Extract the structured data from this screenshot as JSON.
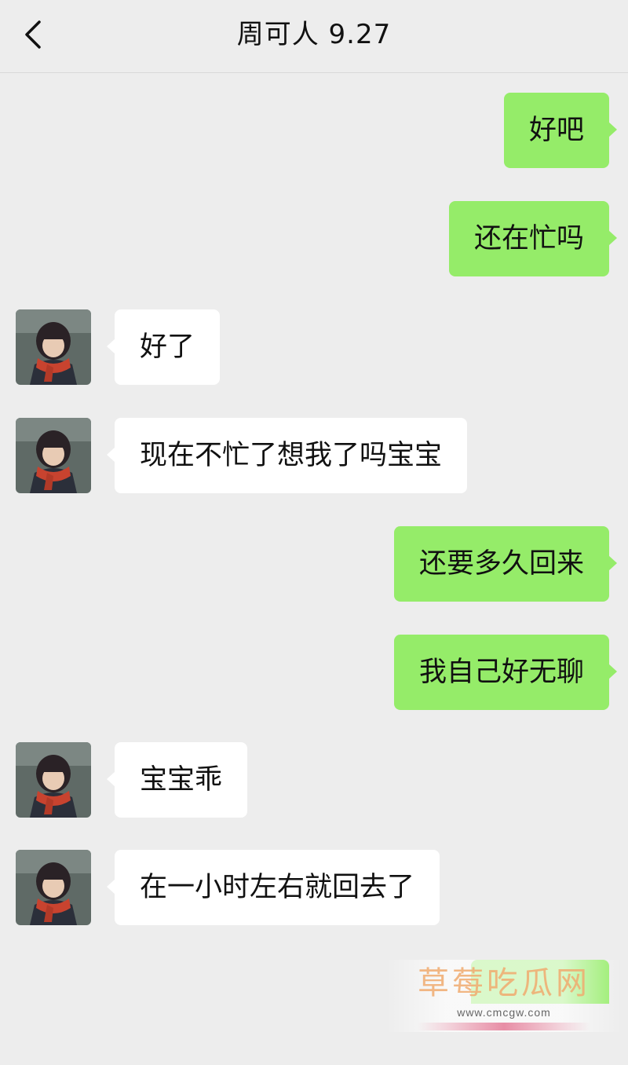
{
  "header": {
    "title": "周可人 9.27",
    "back_icon": "chevron-left-icon"
  },
  "messages": [
    {
      "side": "right",
      "text": "好吧"
    },
    {
      "side": "right",
      "text": "还在忙吗"
    },
    {
      "side": "left",
      "text": "好了"
    },
    {
      "side": "left",
      "text": "现在不忙了想我了吗宝宝"
    },
    {
      "side": "right",
      "text": "还要多久回来"
    },
    {
      "side": "right",
      "text": "我自己好无聊"
    },
    {
      "side": "left",
      "text": "宝宝乖"
    },
    {
      "side": "left",
      "text": "在一小时左右就回去了"
    }
  ],
  "watermark": {
    "text": "草莓吃瓜网",
    "url": "www.cmcgw.com"
  },
  "colors": {
    "background": "#ededed",
    "sent_bubble": "#95ec69",
    "received_bubble": "#ffffff"
  }
}
